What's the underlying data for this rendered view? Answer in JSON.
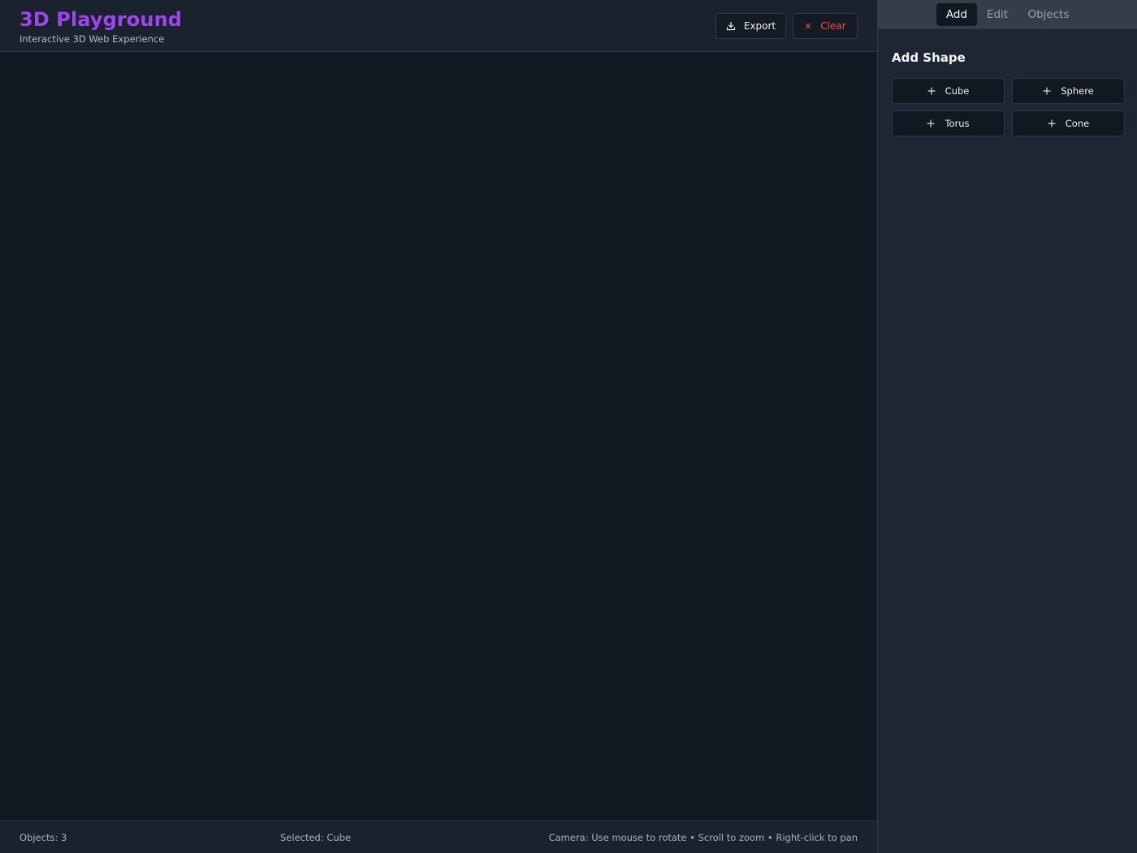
{
  "header": {
    "title": "3D Playground",
    "subtitle": "Interactive 3D Web Experience",
    "export_label": "Export",
    "clear_label": "Clear"
  },
  "status": {
    "objects": "Objects: 3",
    "selected": "Selected: Cube",
    "camera": "Camera: Use mouse to rotate • Scroll to zoom • Right-click to pan"
  },
  "sidebar": {
    "tabs": [
      {
        "label": "Add",
        "active": true
      },
      {
        "label": "Edit",
        "active": false
      },
      {
        "label": "Objects",
        "active": false
      }
    ],
    "section_title": "Add Shape",
    "shapes": [
      {
        "label": "Cube"
      },
      {
        "label": "Sphere"
      },
      {
        "label": "Torus"
      },
      {
        "label": "Cone"
      }
    ]
  },
  "colors": {
    "accent": "#a044ee",
    "danger": "#f04a4a",
    "background": "#111821",
    "panel": "#1a222d",
    "sidebar": "#1d2632"
  },
  "icons": {
    "export": "download-icon",
    "clear": "close-icon",
    "add": "plus-icon"
  }
}
